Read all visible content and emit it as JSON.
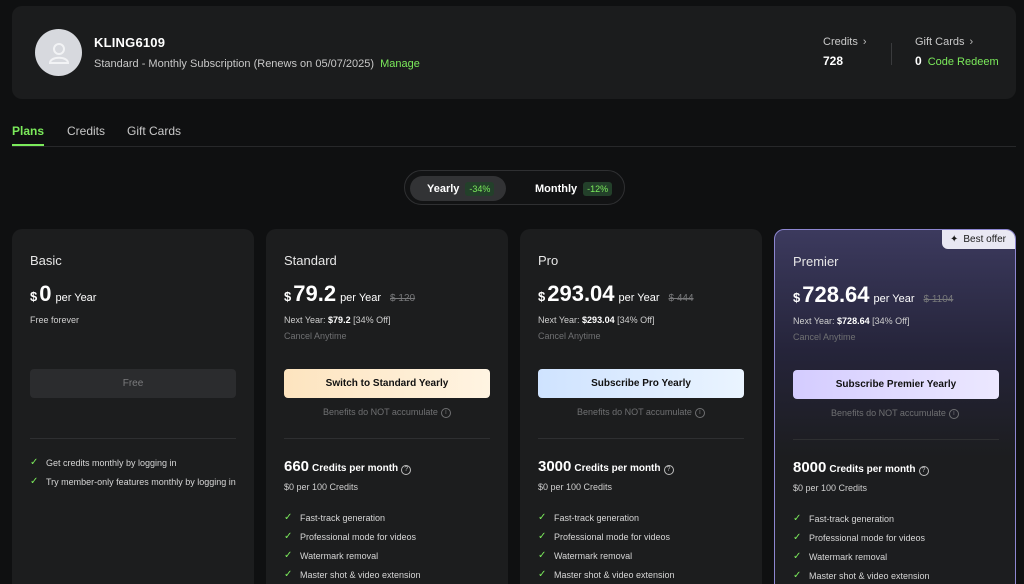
{
  "account": {
    "username": "KLING6109",
    "subscription": "Standard - Monthly Subscription (Renews on 05/07/2025)",
    "manage_label": "Manage",
    "credits_label": "Credits",
    "credits_value": "728",
    "gift_cards_label": "Gift Cards",
    "gift_cards_value": "0",
    "code_redeem_label": "Code Redeem"
  },
  "tabs": [
    {
      "label": "Plans",
      "active": true
    },
    {
      "label": "Credits",
      "active": false
    },
    {
      "label": "Gift Cards",
      "active": false
    }
  ],
  "billing_toggle": {
    "yearly_label": "Yearly",
    "yearly_discount": "-34%",
    "monthly_label": "Monthly",
    "monthly_discount": "-12%",
    "selected": "Yearly"
  },
  "plans": [
    {
      "name": "Basic",
      "currency": "$",
      "price": "0",
      "period": "per Year",
      "subtitle": "Free forever",
      "cta": "Free",
      "features": [
        "Get credits monthly by logging in",
        "Try member-only features monthly by logging in"
      ]
    },
    {
      "name": "Standard",
      "currency": "$",
      "price": "79.2",
      "period": "per Year",
      "old_price": "$ 120",
      "next_year_label": "Next Year:",
      "next_year_price": "$79.2",
      "next_year_discount": "[34% Off]",
      "cancel": "Cancel Anytime",
      "cta": "Switch to Standard Yearly",
      "benefit_note": "Benefits do NOT accumulate",
      "credits": "660",
      "credits_label": "Credits per month",
      "per_100": "$0 per 100 Credits",
      "features": [
        "Fast-track generation",
        "Professional mode for videos",
        "Watermark removal",
        "Master shot & video extension"
      ]
    },
    {
      "name": "Pro",
      "currency": "$",
      "price": "293.04",
      "period": "per Year",
      "old_price": "$ 444",
      "next_year_label": "Next Year:",
      "next_year_price": "$293.04",
      "next_year_discount": "[34% Off]",
      "cancel": "Cancel Anytime",
      "cta": "Subscribe Pro Yearly",
      "benefit_note": "Benefits do NOT accumulate",
      "credits": "3000",
      "credits_label": "Credits per month",
      "per_100": "$0 per 100 Credits",
      "features": [
        "Fast-track generation",
        "Professional mode for videos",
        "Watermark removal",
        "Master shot & video extension"
      ]
    },
    {
      "name": "Premier",
      "badge": "Best offer",
      "currency": "$",
      "price": "728.64",
      "period": "per Year",
      "old_price": "$ 1104",
      "next_year_label": "Next Year:",
      "next_year_price": "$728.64",
      "next_year_discount": "[34% Off]",
      "cancel": "Cancel Anytime",
      "cta": "Subscribe Premier Yearly",
      "benefit_note": "Benefits do NOT accumulate",
      "credits": "8000",
      "credits_label": "Credits per month",
      "per_100": "$0 per 100 Credits",
      "features": [
        "Fast-track generation",
        "Professional mode for videos",
        "Watermark removal",
        "Master shot & video extension"
      ]
    }
  ],
  "colors": {
    "accent": "#7bea5b",
    "background": "#0f1011",
    "card": "#1c1d1e"
  }
}
